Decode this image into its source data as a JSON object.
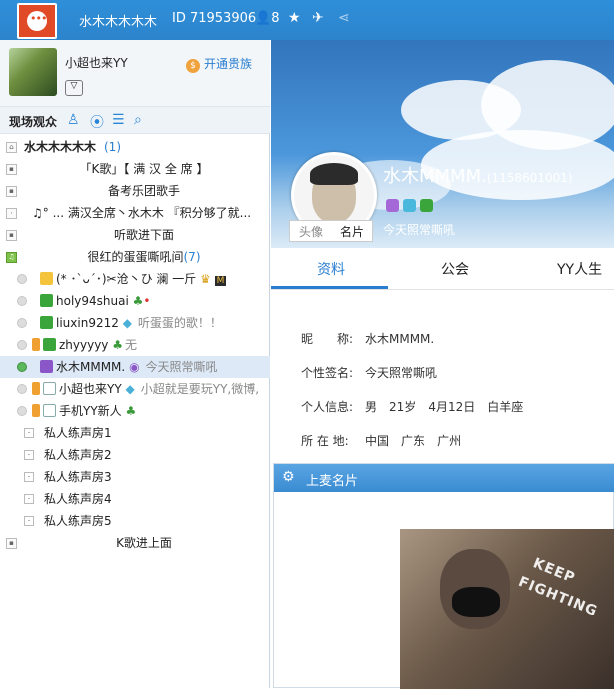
{
  "topbar": {
    "channel_name": "水木木木木木",
    "id_label": "ID 71953906",
    "online_count": "8"
  },
  "profile": {
    "username": "小超也来YY",
    "noble_label": "开通贵族"
  },
  "toolbar": {
    "label": "现场观众"
  },
  "tree": {
    "channel": {
      "name": "水木木木木木",
      "count": "(1)"
    },
    "rooms_top": [
      "「K歌」【 满 汉 全 席 】",
      "备考乐团歌手",
      "♫° ... 满汉全席丶水木木 『积分够了就..."
    ],
    "room_listen": "听歌进下面",
    "room_current": {
      "name": "很红的蛋蛋嘶吼间",
      "count": "(7)"
    },
    "users": [
      {
        "name": "(* ･`ᴗ´･)✂沧丶ひ 澜 一斤",
        "sig": ""
      },
      {
        "name": "holy94shuai",
        "sig": ""
      },
      {
        "name": "liuxin9212",
        "sig": "听蛋蛋的歌！！"
      },
      {
        "name": "zhyyyyy",
        "sig": "无"
      },
      {
        "name": "水木MMMM.",
        "sig": "今天照常嘶吼"
      },
      {
        "name": "小超也来YY",
        "sig": "小超就是要玩YY,微博,"
      },
      {
        "name": "手机YY新人",
        "sig": ""
      }
    ],
    "practice_rooms": [
      "私人练声房1",
      "私人练声房2",
      "私人练声房3",
      "私人练声房4",
      "私人练声房5"
    ],
    "room_bottom": "K歌进上面"
  },
  "header": {
    "name": "水木MMMM.",
    "uid": "(1158601001)",
    "signature": "今天照常嘶吼",
    "avatar_tab": "头像",
    "card_tab": "名片"
  },
  "tabs": [
    "资料",
    "公会",
    "YY人生"
  ],
  "info": {
    "nickname_label": "昵　　称:",
    "nickname": "水木MMMM.",
    "signature_label": "个性签名:",
    "signature": "今天照常嘶吼",
    "personal_label": "个人信息:",
    "gender": "男",
    "age": "21岁",
    "birthday": "4月12日",
    "zodiac": "白羊座",
    "location_label": "所 在 地:",
    "country": "中国",
    "province": "广东",
    "city": "广州"
  },
  "card": {
    "title": "上麦名片",
    "photo_text1": "KEEP",
    "photo_text2": "FIGHTING"
  },
  "colors": {
    "accent": "#2a7ed0",
    "topbar": "#2f8fd9",
    "header_card": "#3a8bd2"
  }
}
